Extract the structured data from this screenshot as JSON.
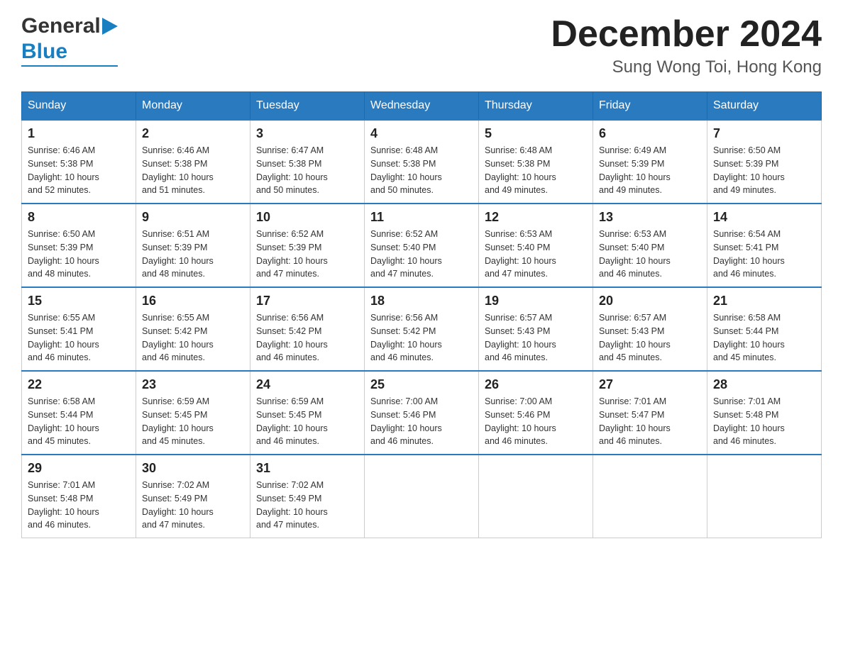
{
  "header": {
    "logo_general": "General",
    "logo_blue": "Blue",
    "month_title": "December 2024",
    "location": "Sung Wong Toi, Hong Kong"
  },
  "days_of_week": [
    "Sunday",
    "Monday",
    "Tuesday",
    "Wednesday",
    "Thursday",
    "Friday",
    "Saturday"
  ],
  "weeks": [
    [
      {
        "num": "1",
        "sunrise": "6:46 AM",
        "sunset": "5:38 PM",
        "daylight": "10 hours and 52 minutes."
      },
      {
        "num": "2",
        "sunrise": "6:46 AM",
        "sunset": "5:38 PM",
        "daylight": "10 hours and 51 minutes."
      },
      {
        "num": "3",
        "sunrise": "6:47 AM",
        "sunset": "5:38 PM",
        "daylight": "10 hours and 50 minutes."
      },
      {
        "num": "4",
        "sunrise": "6:48 AM",
        "sunset": "5:38 PM",
        "daylight": "10 hours and 50 minutes."
      },
      {
        "num": "5",
        "sunrise": "6:48 AM",
        "sunset": "5:38 PM",
        "daylight": "10 hours and 49 minutes."
      },
      {
        "num": "6",
        "sunrise": "6:49 AM",
        "sunset": "5:39 PM",
        "daylight": "10 hours and 49 minutes."
      },
      {
        "num": "7",
        "sunrise": "6:50 AM",
        "sunset": "5:39 PM",
        "daylight": "10 hours and 49 minutes."
      }
    ],
    [
      {
        "num": "8",
        "sunrise": "6:50 AM",
        "sunset": "5:39 PM",
        "daylight": "10 hours and 48 minutes."
      },
      {
        "num": "9",
        "sunrise": "6:51 AM",
        "sunset": "5:39 PM",
        "daylight": "10 hours and 48 minutes."
      },
      {
        "num": "10",
        "sunrise": "6:52 AM",
        "sunset": "5:39 PM",
        "daylight": "10 hours and 47 minutes."
      },
      {
        "num": "11",
        "sunrise": "6:52 AM",
        "sunset": "5:40 PM",
        "daylight": "10 hours and 47 minutes."
      },
      {
        "num": "12",
        "sunrise": "6:53 AM",
        "sunset": "5:40 PM",
        "daylight": "10 hours and 47 minutes."
      },
      {
        "num": "13",
        "sunrise": "6:53 AM",
        "sunset": "5:40 PM",
        "daylight": "10 hours and 46 minutes."
      },
      {
        "num": "14",
        "sunrise": "6:54 AM",
        "sunset": "5:41 PM",
        "daylight": "10 hours and 46 minutes."
      }
    ],
    [
      {
        "num": "15",
        "sunrise": "6:55 AM",
        "sunset": "5:41 PM",
        "daylight": "10 hours and 46 minutes."
      },
      {
        "num": "16",
        "sunrise": "6:55 AM",
        "sunset": "5:42 PM",
        "daylight": "10 hours and 46 minutes."
      },
      {
        "num": "17",
        "sunrise": "6:56 AM",
        "sunset": "5:42 PM",
        "daylight": "10 hours and 46 minutes."
      },
      {
        "num": "18",
        "sunrise": "6:56 AM",
        "sunset": "5:42 PM",
        "daylight": "10 hours and 46 minutes."
      },
      {
        "num": "19",
        "sunrise": "6:57 AM",
        "sunset": "5:43 PM",
        "daylight": "10 hours and 46 minutes."
      },
      {
        "num": "20",
        "sunrise": "6:57 AM",
        "sunset": "5:43 PM",
        "daylight": "10 hours and 45 minutes."
      },
      {
        "num": "21",
        "sunrise": "6:58 AM",
        "sunset": "5:44 PM",
        "daylight": "10 hours and 45 minutes."
      }
    ],
    [
      {
        "num": "22",
        "sunrise": "6:58 AM",
        "sunset": "5:44 PM",
        "daylight": "10 hours and 45 minutes."
      },
      {
        "num": "23",
        "sunrise": "6:59 AM",
        "sunset": "5:45 PM",
        "daylight": "10 hours and 45 minutes."
      },
      {
        "num": "24",
        "sunrise": "6:59 AM",
        "sunset": "5:45 PM",
        "daylight": "10 hours and 46 minutes."
      },
      {
        "num": "25",
        "sunrise": "7:00 AM",
        "sunset": "5:46 PM",
        "daylight": "10 hours and 46 minutes."
      },
      {
        "num": "26",
        "sunrise": "7:00 AM",
        "sunset": "5:46 PM",
        "daylight": "10 hours and 46 minutes."
      },
      {
        "num": "27",
        "sunrise": "7:01 AM",
        "sunset": "5:47 PM",
        "daylight": "10 hours and 46 minutes."
      },
      {
        "num": "28",
        "sunrise": "7:01 AM",
        "sunset": "5:48 PM",
        "daylight": "10 hours and 46 minutes."
      }
    ],
    [
      {
        "num": "29",
        "sunrise": "7:01 AM",
        "sunset": "5:48 PM",
        "daylight": "10 hours and 46 minutes."
      },
      {
        "num": "30",
        "sunrise": "7:02 AM",
        "sunset": "5:49 PM",
        "daylight": "10 hours and 47 minutes."
      },
      {
        "num": "31",
        "sunrise": "7:02 AM",
        "sunset": "5:49 PM",
        "daylight": "10 hours and 47 minutes."
      },
      null,
      null,
      null,
      null
    ]
  ],
  "labels": {
    "sunrise": "Sunrise:",
    "sunset": "Sunset:",
    "daylight": "Daylight:"
  }
}
